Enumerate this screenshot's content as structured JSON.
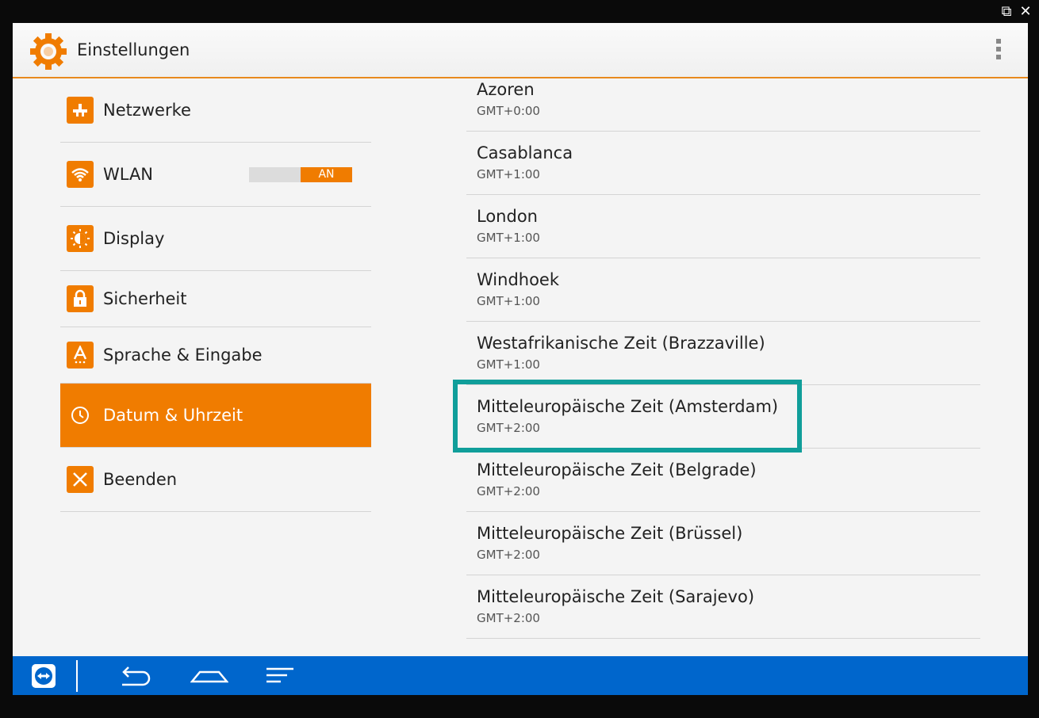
{
  "app": {
    "title": "Einstellungen"
  },
  "window_controls": {
    "popout": "⧉",
    "close": "✕"
  },
  "sidebar": {
    "items": [
      {
        "label": "Netzwerke",
        "icon": "network-icon"
      },
      {
        "label": "WLAN",
        "icon": "wifi-icon",
        "toggle": "AN"
      },
      {
        "label": "Display",
        "icon": "brightness-icon"
      },
      {
        "label": "Sicherheit",
        "icon": "lock-icon"
      },
      {
        "label": "Sprache & Eingabe",
        "icon": "language-icon"
      },
      {
        "label": "Datum & Uhrzeit",
        "icon": "clock-icon",
        "active": true
      },
      {
        "label": "Beenden",
        "icon": "close-icon"
      }
    ]
  },
  "timezones": [
    {
      "name": "Azoren",
      "offset": "GMT+0:00"
    },
    {
      "name": "Casablanca",
      "offset": "GMT+1:00"
    },
    {
      "name": "London",
      "offset": "GMT+1:00"
    },
    {
      "name": "Windhoek",
      "offset": "GMT+1:00"
    },
    {
      "name": "Westafrikanische Zeit (Brazzaville)",
      "offset": "GMT+1:00"
    },
    {
      "name": "Mitteleuropäische Zeit (Amsterdam)",
      "offset": "GMT+2:00",
      "highlighted": true
    },
    {
      "name": "Mitteleuropäische Zeit (Belgrade)",
      "offset": "GMT+2:00"
    },
    {
      "name": "Mitteleuropäische Zeit (Brüssel)",
      "offset": "GMT+2:00"
    },
    {
      "name": "Mitteleuropäische Zeit (Sarajevo)",
      "offset": "GMT+2:00"
    }
  ],
  "colors": {
    "accent": "#f07c00",
    "highlight": "#109e9a",
    "navbar": "#0066cc"
  },
  "navbar": {
    "icons": [
      "teamviewer-icon",
      "back-icon",
      "home-icon",
      "recents-icon"
    ]
  }
}
